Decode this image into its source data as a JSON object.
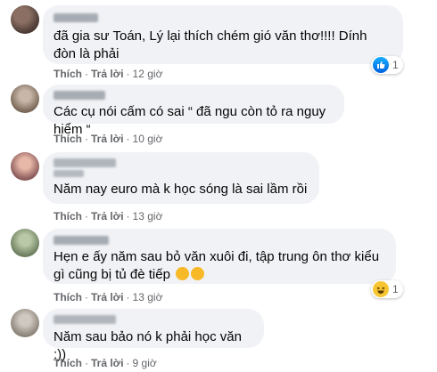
{
  "comments": [
    {
      "text": "đã gia sư Toán, Lý lại thích chém gió văn thơ!!!! Dính đòn là phải",
      "like": "Thích",
      "reply": "Trả lời",
      "time": "12 giờ",
      "reaction_count": "1",
      "reaction_type": "like-icon"
    },
    {
      "text": "Các cụ nói cấm có sai “ đã ngu còn tỏ ra nguy hiểm “",
      "like": "Thích",
      "reply": "Trả lời",
      "time": "10 giờ"
    },
    {
      "text": "Năm nay euro mà k học sóng là sai lầm rồi",
      "like": "Thích",
      "reply": "Trả lời",
      "time": "13 giờ"
    },
    {
      "text": "Hẹn e ấy năm sau bỏ văn xuôi đi, tập trung ôn thơ kiểu gì cũng bị tủ đè tiếp",
      "like": "Thích",
      "reply": "Trả lời",
      "time": "13 giờ",
      "reaction_count": "1",
      "reaction_type": "haha-icon"
    },
    {
      "text": "Năm sau bảo nó k phải học văn :))",
      "like": "Thích",
      "reply": "Trả lời",
      "time": "9 giờ"
    }
  ],
  "separator": "·",
  "colors": {
    "bubble": "#f0f2f5",
    "meta": "#65676b",
    "like_blue": "#1877f2",
    "haha_yellow": "#f7c531"
  }
}
